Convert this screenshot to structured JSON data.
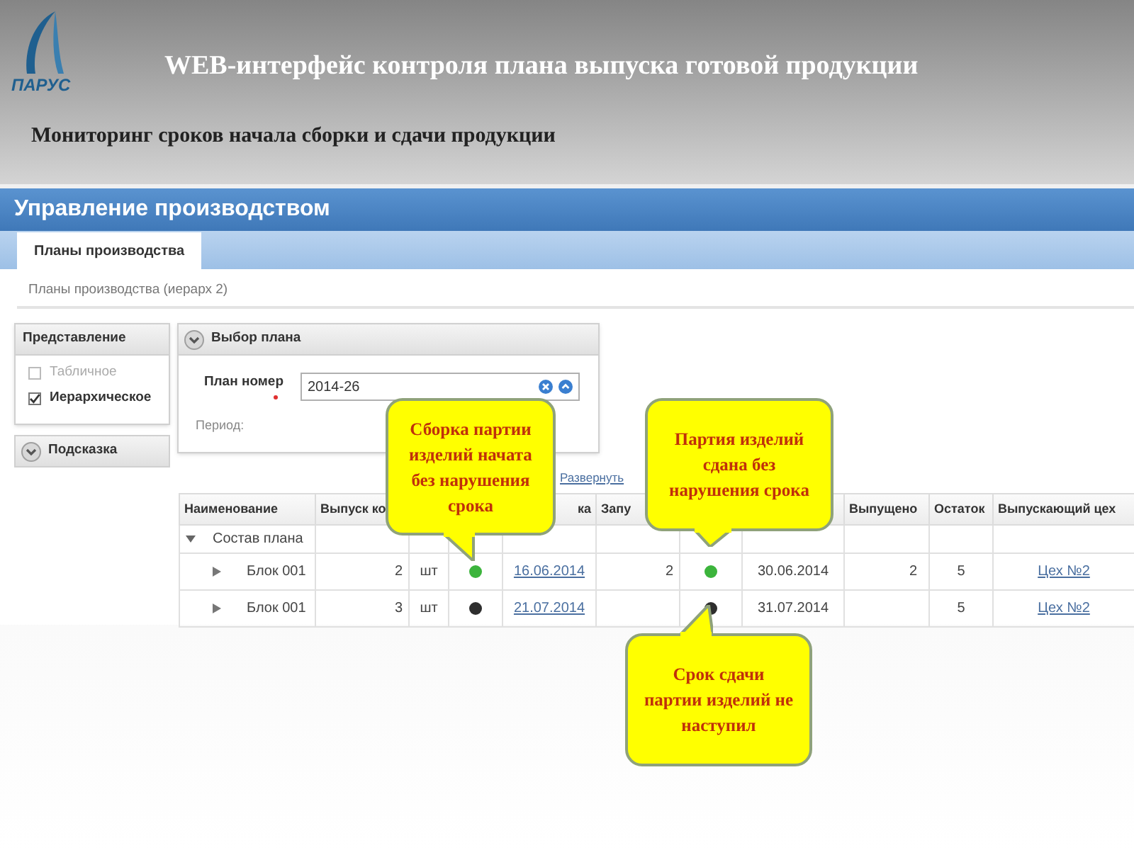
{
  "slide": {
    "logo_text": "ПАРУС",
    "title": "WEB-интерфейс контроля плана выпуска готовой продукции",
    "subtitle": "Мониторинг сроков начала сборки и сдачи продукции"
  },
  "app": {
    "title": "Управление производством",
    "tabs": [
      {
        "label": "Планы производства",
        "selected": true
      }
    ],
    "breadcrumb": "Планы производства (иерарх 2)",
    "view_panel": {
      "title": "Представление",
      "options": [
        {
          "label": "Табличное",
          "checked": false
        },
        {
          "label": "Иерархическое",
          "checked": true
        }
      ]
    },
    "hint_panel": {
      "title": "Подсказка",
      "expanded": false
    },
    "plan_panel": {
      "title": "Выбор плана",
      "expanded": true,
      "plan_label": "План номер",
      "required": true,
      "plan_value": "2014-26",
      "period_label": "Период:"
    },
    "expand_link": "Развернуть",
    "table": {
      "columns": [
        {
          "label": "Наименование"
        },
        {
          "label": "Выпуск ко"
        },
        {},
        {},
        {
          "label": "ка"
        },
        {
          "label": "Запу"
        },
        {},
        {},
        {
          "label": "Выпущено"
        },
        {
          "label": "Остаток"
        },
        {
          "label": "Выпускающий цех"
        }
      ],
      "group": {
        "label": "Состав плана",
        "expanded": true
      },
      "rows": [
        {
          "name": "Блок 001",
          "expanded": false,
          "quantity": "2",
          "unit": "шт",
          "start_status": {
            "color": "#3cb43c"
          },
          "start_date": "16.06.2014",
          "launched": "2",
          "delivery_status": {
            "color": "#3cb43c"
          },
          "delivery_date": "30.06.2014",
          "released": "2",
          "remaining": "5",
          "workshop": "Цех №2"
        },
        {
          "name": "Блок 001",
          "expanded": false,
          "quantity": "3",
          "unit": "шт",
          "start_status": {
            "color": "#2e2e2e"
          },
          "start_date": "21.07.2014",
          "delivery_status": {
            "color": "#2e2e2e"
          },
          "delivery_date": "31.07.2014",
          "remaining": "5",
          "workshop": "Цех №2"
        }
      ]
    }
  },
  "callouts": [
    {
      "text": "Сборка партии изделий начата без нарушения срока"
    },
    {
      "text": "Партия изделий сдана без нарушения срока"
    },
    {
      "text": "Срок сдачи партии изделий не наступил"
    }
  ]
}
